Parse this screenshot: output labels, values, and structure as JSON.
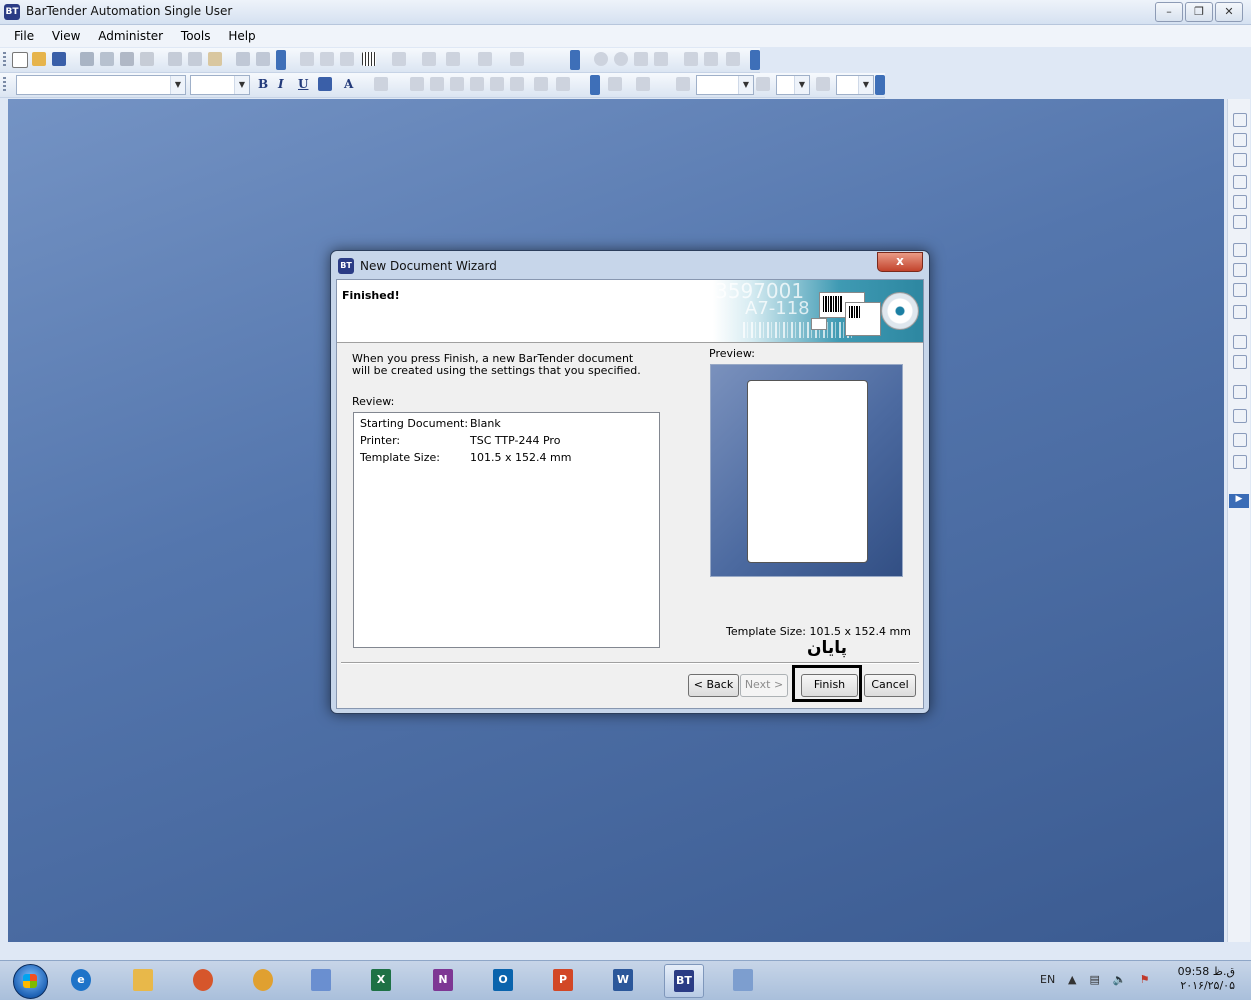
{
  "window": {
    "title": "BarTender Automation Single User",
    "controls": [
      "minimize-icon",
      "restore-icon",
      "close-icon"
    ]
  },
  "menu": [
    "File",
    "View",
    "Administer",
    "Tools",
    "Help"
  ],
  "dialog": {
    "title": "New Document Wizard",
    "close_label": "x",
    "header_title": "Finished!",
    "banner_text_1": "3597001",
    "banner_text_2": "A7-118",
    "intro": "When you press Finish, a new BarTender document will be created using the settings that you specified.",
    "review_label": "Review:",
    "review": [
      {
        "key": "Starting Document:",
        "value": "Blank"
      },
      {
        "key": "Printer:",
        "value": "TSC TTP-244 Pro"
      },
      {
        "key": "Template Size:",
        "value": "101.5 x 152.4 mm"
      }
    ],
    "preview_label": "Preview:",
    "template_size_caption": "Template Size:  101.5 x 152.4 mm",
    "annotation": "پایان",
    "buttons": {
      "back": "< Back",
      "next": "Next >",
      "finish": "Finish",
      "cancel": "Cancel"
    }
  },
  "taskbar": {
    "apps": [
      {
        "name": "ie",
        "label": "e",
        "color": "#1e73c8"
      },
      {
        "name": "explorer",
        "label": "",
        "color": "#e8b84a"
      },
      {
        "name": "media",
        "label": "",
        "color": "#d6562b"
      },
      {
        "name": "chrome",
        "label": "",
        "color": "#e0a030"
      },
      {
        "name": "paint",
        "label": "",
        "color": "#6a8fd0"
      },
      {
        "name": "excel",
        "label": "X",
        "color": "#1e7145"
      },
      {
        "name": "onenote",
        "label": "N",
        "color": "#7e3794"
      },
      {
        "name": "outlook",
        "label": "O",
        "color": "#0a64ad"
      },
      {
        "name": "powerpoint",
        "label": "P",
        "color": "#d24726"
      },
      {
        "name": "word",
        "label": "W",
        "color": "#2b579a"
      },
      {
        "name": "bartender",
        "label": "BT",
        "color": "#2b3c85"
      },
      {
        "name": "paint-brush",
        "label": "",
        "color": "#7d9ecf"
      }
    ],
    "language": "EN",
    "time": "09:58 ق.ظ",
    "date": "۲۰۱۶/۲۵/۰۵"
  }
}
